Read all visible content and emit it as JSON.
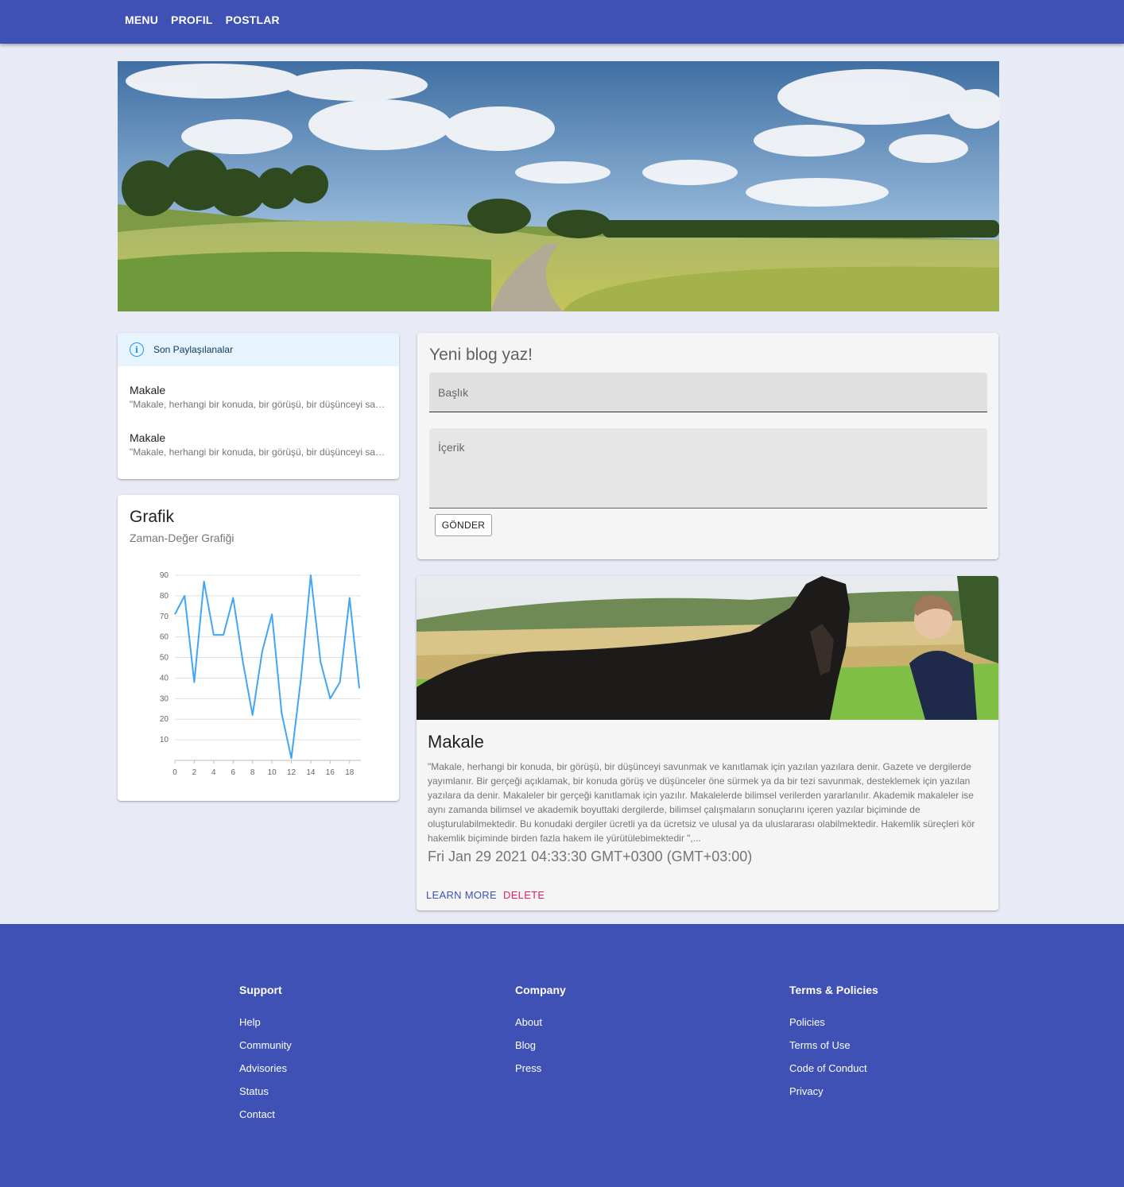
{
  "nav": {
    "items": [
      "MENU",
      "PROFIL",
      "POSTLAR"
    ]
  },
  "recent": {
    "heading": "Son Paylaşılanalar",
    "items": [
      {
        "title": "Makale",
        "excerpt": "\"Makale, herhangi bir konuda, bir görüşü, bir düşünceyi savunmak ve kanıtlamak için yazılan yazılara denir."
      },
      {
        "title": "Makale",
        "excerpt": "\"Makale, herhangi bir konuda, bir görüşü, bir düşünceyi savunmak ve kanıtlamak için yazılan yazılara denir."
      }
    ]
  },
  "chart": {
    "title": "Grafik",
    "subtitle": "Zaman-Değer Grafiği"
  },
  "chart_data": {
    "type": "line",
    "x": [
      0,
      1,
      2,
      3,
      4,
      5,
      6,
      7,
      8,
      9,
      10,
      11,
      12,
      13,
      14,
      15,
      16,
      17,
      18,
      19
    ],
    "values": [
      71,
      80,
      38,
      87,
      61,
      61,
      79,
      48,
      22,
      53,
      71,
      23,
      1,
      40,
      90,
      48,
      30,
      38,
      79,
      35
    ],
    "xticks": [
      "0",
      "2",
      "4",
      "6",
      "8",
      "10",
      "12",
      "14",
      "16",
      "18"
    ],
    "yticks": [
      "10",
      "20",
      "30",
      "40",
      "50",
      "60",
      "70",
      "80",
      "90"
    ],
    "ylim": [
      0,
      90
    ],
    "xlim": [
      0,
      19
    ],
    "grid": true,
    "color": "#42a5f5"
  },
  "writer": {
    "heading": "Yeni blog yaz!",
    "title_placeholder": "Başlık",
    "content_placeholder": "İçerik",
    "submit_label": "GÖNDER"
  },
  "post": {
    "title": "Makale",
    "body": "\"Makale, herhangi bir konuda, bir görüşü, bir düşünceyi savunmak ve kanıtlamak için yazılan yazılara denir. Gazete ve dergilerde yayımlanır. Bir gerçeği açıklamak, bir konuda görüş ve düşünceler öne sürmek ya da bir tezi savunmak, desteklemek için yazılan yazılara da denir. Makaleler bir gerçeği kanıtlamak için yazılır. Makalelerde bilimsel verilerden yararlanılır. Akademik makaleler ise aynı zamanda bilimsel ve akademik boyuttaki dergilerde, bilimsel çalışmaların sonuçlarını içeren yazılar biçiminde de oluşturulabilmektedir. Bu konudaki dergiler ücretli ya da ücretsiz ve ulusal ya da uluslararası olabilmektedir. Hakemlik süreçleri kör hakemlik biçiminde birden fazla hakem ile yürütülebimektedir \",...",
    "date": "Fri Jan 29 2021 04:33:30 GMT+0300 (GMT+03:00)",
    "learn_more": "LEARN MORE",
    "delete": "DELETE"
  },
  "footer": {
    "support": {
      "title": "Support",
      "links": [
        "Help",
        "Community",
        "Advisories",
        "Status",
        "Contact"
      ]
    },
    "company": {
      "title": "Company",
      "links": [
        "About",
        "Blog",
        "Press"
      ]
    },
    "terms": {
      "title": "Terms & Policies",
      "links": [
        "Policies",
        "Terms of Use",
        "Code of Conduct",
        "Privacy"
      ]
    }
  },
  "colors": {
    "primary": "#3f51b5",
    "accent": "#e91e63",
    "background": "#e8eaf6",
    "info": "#2196f3"
  }
}
